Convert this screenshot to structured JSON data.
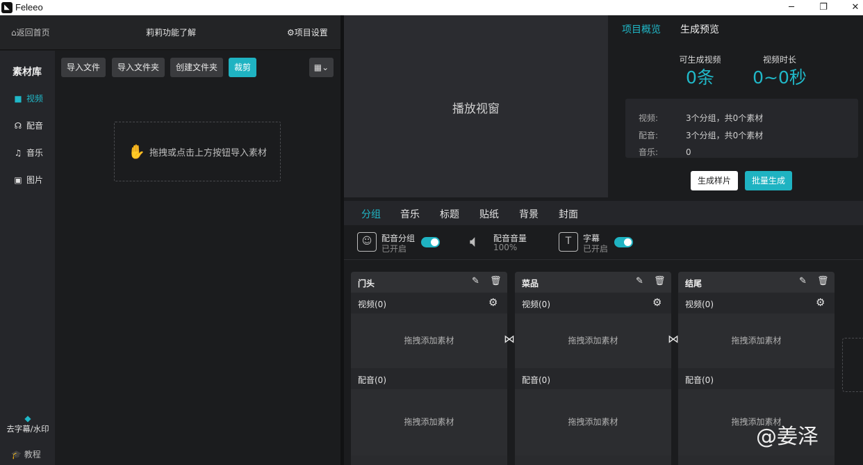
{
  "window": {
    "app_name": "Feleeo",
    "minimize_icon": "minimize-icon",
    "restore_icon": "restore-icon",
    "close_icon": "close-icon"
  },
  "topbar": {
    "back_label": "返回首页",
    "project_name": "莉莉功能了解",
    "settings_label": "项目设置"
  },
  "sidebar": {
    "title": "素材库",
    "items": [
      {
        "label": "视频",
        "icon": "video-camera-icon",
        "active": true
      },
      {
        "label": "配音",
        "icon": "voice-icon",
        "active": false
      },
      {
        "label": "音乐",
        "icon": "music-note-icon",
        "active": false
      },
      {
        "label": "图片",
        "icon": "image-icon",
        "active": false
      }
    ],
    "watermark_tool": "去字幕/水印",
    "tutorial": "教程"
  },
  "library": {
    "buttons": [
      "导入文件",
      "导入文件夹",
      "创建文件夹",
      "裁剪"
    ],
    "dropzone_text": "拖拽或点击上方按钮导入素材"
  },
  "player": {
    "label": "播放视窗"
  },
  "overview": {
    "tabs": [
      "项目概览",
      "生成预览"
    ],
    "stats": [
      {
        "label": "可生成视频",
        "value": "0条"
      },
      {
        "label": "视频时长",
        "value": "0~0秒"
      }
    ],
    "info": [
      {
        "key": "视频:",
        "value": "3个分组，共0个素材"
      },
      {
        "key": "配音:",
        "value": "3个分组，共0个素材"
      },
      {
        "key": "音乐:",
        "value": "0"
      }
    ],
    "sample_button": "生成样片",
    "batch_button": "批量生成"
  },
  "editor": {
    "tabs": [
      "分组",
      "音乐",
      "标题",
      "贴纸",
      "背景",
      "封面"
    ],
    "toggles": {
      "voice_group": {
        "title": "配音分组",
        "status": "已开启"
      },
      "voice_volume": {
        "title": "配音音量",
        "status": "100%"
      },
      "subtitle": {
        "title": "字幕",
        "status": "已开启"
      }
    }
  },
  "groups": [
    {
      "name": "门头",
      "video_label": "视频(0)",
      "voice_label": "配音(0)",
      "drop_text": "拖拽添加素材"
    },
    {
      "name": "菜品",
      "video_label": "视频(0)",
      "voice_label": "配音(0)",
      "drop_text": "拖拽添加素材"
    },
    {
      "name": "结尾",
      "video_label": "视频(0)",
      "voice_label": "配音(0)",
      "drop_text": "拖拽添加素材"
    }
  ],
  "watermark_text": "@姜泽",
  "colors": {
    "accent": "#20b8c8",
    "background": "#1b1c1e",
    "panel": "#2a2b2e"
  }
}
